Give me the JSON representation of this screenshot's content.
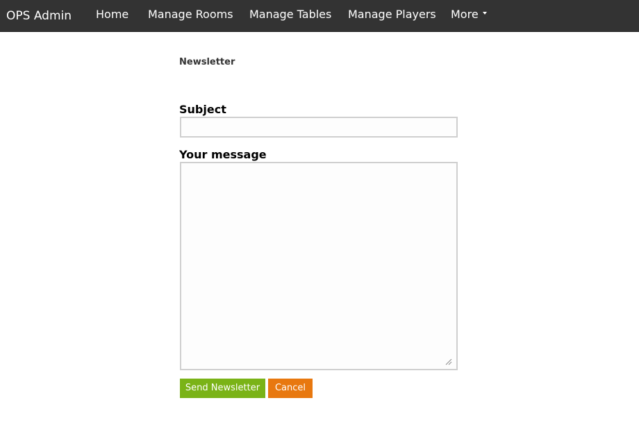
{
  "navbar": {
    "brand": "OPS Admin",
    "items": [
      {
        "label": "Home"
      },
      {
        "label": "Manage Rooms"
      },
      {
        "label": "Manage Tables"
      },
      {
        "label": "Manage Players"
      },
      {
        "label": "More"
      }
    ],
    "background_color": "#333333"
  },
  "page": {
    "heading": "Newsletter"
  },
  "form": {
    "subject_label": "Subject",
    "subject_value": "",
    "message_label": "Your message",
    "message_value": "",
    "send_label": "Send Newsletter",
    "cancel_label": "Cancel",
    "send_color": "#7ab317",
    "cancel_color": "#e8780f"
  },
  "icons": {
    "more_dropdown": "caret-down-icon",
    "textarea_resize": "resize-grip-icon"
  }
}
